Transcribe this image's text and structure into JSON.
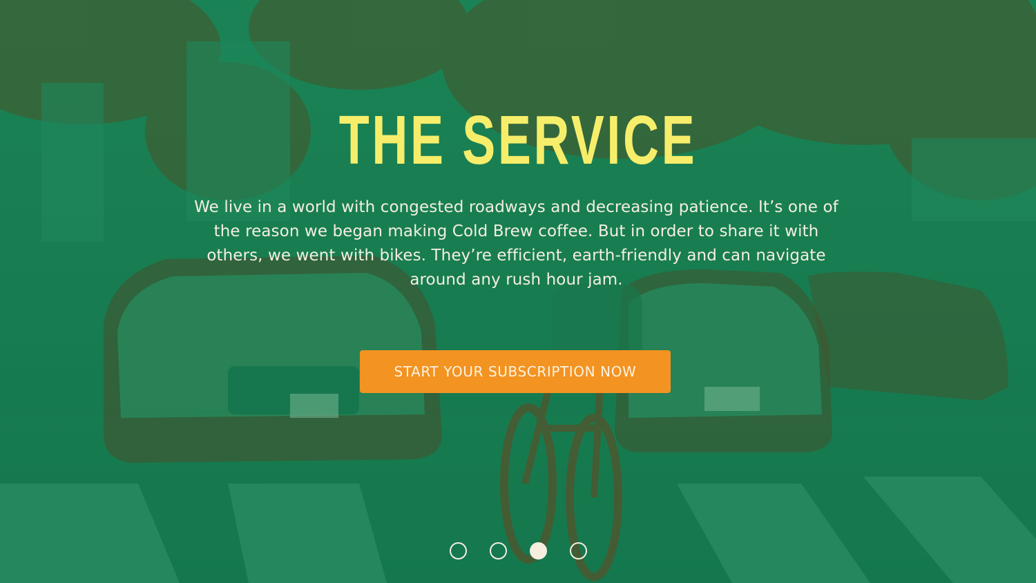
{
  "hero": {
    "title": "THE SERVICE",
    "description": "We live in a world with congested roadways and decreasing patience. It’s one of the reason we began making Cold Brew coffee. But in order to share it with others, we went with bikes. They’re efficient, earth-friendly and can navigate around any rush hour jam.",
    "cta_label": "START YOUR SUBSCRIPTION NOW",
    "background_image": "bike-courier-in-traffic-photo"
  },
  "carousel": {
    "slide_count": 4,
    "active_index": 2
  },
  "colors": {
    "overlay_green": "#1a7f53",
    "shadow_brown": "#6b3a1a",
    "title_yellow": "#f6ee6a",
    "button_orange": "#f39321",
    "text_cream": "#f4efe2"
  }
}
